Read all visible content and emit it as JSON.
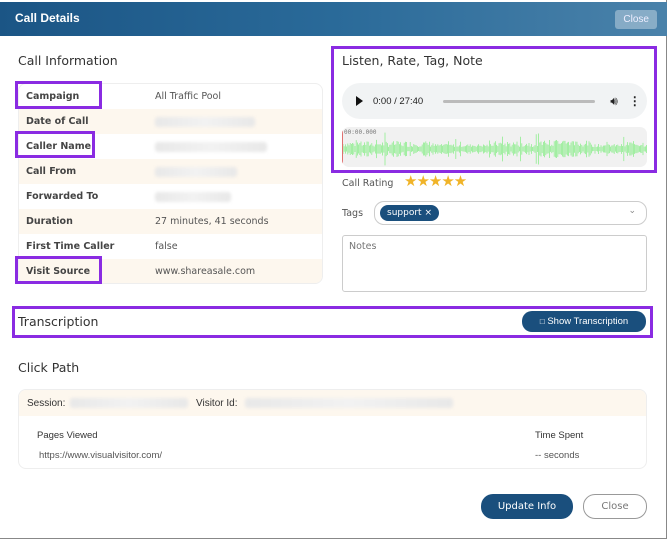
{
  "header": {
    "title": "Call Details",
    "close_label": "Close"
  },
  "call_info": {
    "title": "Call Information",
    "rows": [
      {
        "label": "Campaign",
        "value": "All Traffic Pool",
        "redacted": false
      },
      {
        "label": "Date of Call",
        "value": "",
        "redacted": true
      },
      {
        "label": "Caller Name",
        "value": "",
        "redacted": true
      },
      {
        "label": "Call From",
        "value": "",
        "redacted": true
      },
      {
        "label": "Forwarded To",
        "value": "",
        "redacted": true
      },
      {
        "label": "Duration",
        "value": "27 minutes, 41 seconds",
        "redacted": false
      },
      {
        "label": "First Time Caller",
        "value": "false",
        "redacted": false
      },
      {
        "label": "Visit Source",
        "value": "www.shareasale.com",
        "redacted": false
      }
    ]
  },
  "listen": {
    "title": "Listen, Rate, Tag, Note",
    "player": {
      "time": "0:00 / 27:40",
      "progress": 0
    },
    "waveform": {
      "timestamp": "00:00.000",
      "color": "#90ee90"
    },
    "rating": {
      "label": "Call Rating",
      "stars": "★★★★★",
      "value": 5,
      "max": 5
    },
    "tags": {
      "label": "Tags",
      "items": [
        "support"
      ],
      "remove_glyph": "×",
      "chevron": "⌄"
    },
    "notes": {
      "placeholder": "Notes",
      "value": ""
    }
  },
  "transcription": {
    "title": "Transcription",
    "button_label": "Show Transcription",
    "button_icon": "🗨"
  },
  "click_path": {
    "title": "Click Path",
    "session_label": "Session:",
    "visitor_label": "Visitor Id:",
    "columns": [
      "Pages Viewed",
      "Time Spent"
    ],
    "rows": [
      {
        "page": "https://www.visualvisitor.com/",
        "time": "-- seconds"
      }
    ]
  },
  "footer": {
    "update_label": "Update Info",
    "close_label": "Close"
  },
  "colors": {
    "primary": "#1a4f7d",
    "highlight": "#8a2be2",
    "star": "#f0b429",
    "row_alt": "#fdf7ee"
  }
}
